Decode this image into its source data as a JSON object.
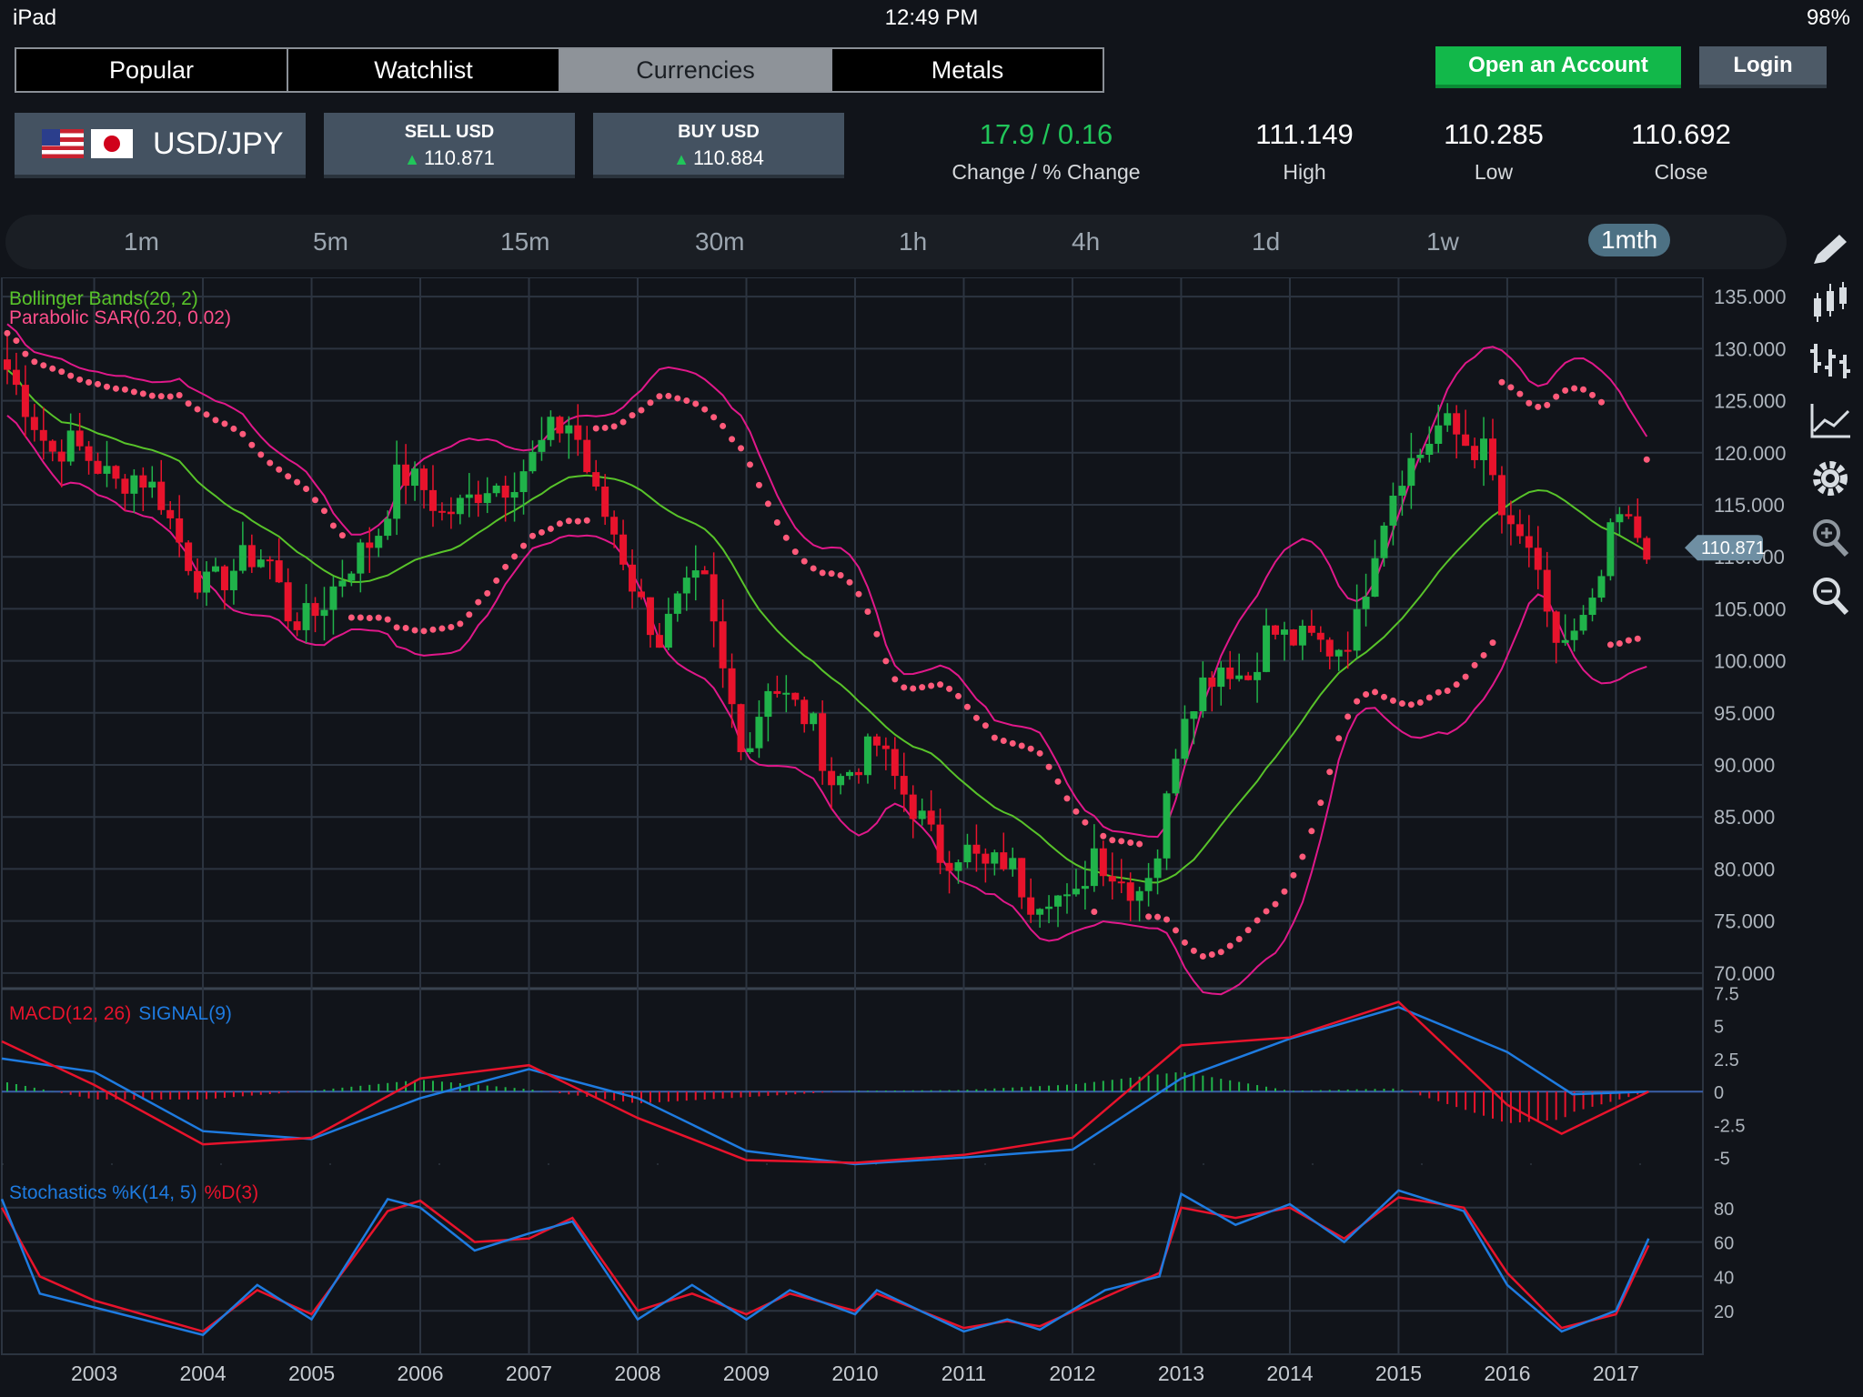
{
  "status": {
    "device": "iPad",
    "time": "12:49 PM",
    "battery": "98%"
  },
  "tabs": [
    {
      "label": "Popular",
      "active": false
    },
    {
      "label": "Watchlist",
      "active": false
    },
    {
      "label": "Currencies",
      "active": true
    },
    {
      "label": "Metals",
      "active": false
    }
  ],
  "actions": {
    "open_account": "Open an Account",
    "login": "Login"
  },
  "instrument": {
    "pair": "USD/JPY"
  },
  "sell": {
    "label": "SELL USD",
    "price": "110.871"
  },
  "buy": {
    "label": "BUY USD",
    "price": "110.884"
  },
  "stats": {
    "change_value": "17.9 / 0.16",
    "change_label": "Change / % Change",
    "high_value": "111.149",
    "high_label": "High",
    "low_value": "110.285",
    "low_label": "Low",
    "close_value": "110.692",
    "close_label": "Close"
  },
  "timeframes": [
    "1m",
    "5m",
    "15m",
    "30m",
    "1h",
    "4h",
    "1d",
    "1w",
    "1mth"
  ],
  "active_timeframe": "1mth",
  "colors": {
    "up": "#20b34a",
    "down": "#e8132c",
    "bollinger": "#e0188a",
    "sma": "#58c32a",
    "sar": "#ff5a7a",
    "macd": "#e8132c",
    "signal": "#1e7be0",
    "accent": "#12b84a"
  },
  "chart_data": [
    {
      "type": "candlestick",
      "indicators": [
        "Bollinger Bands(20, 2)",
        "Parabolic SAR(0.20, 0.02)"
      ],
      "x_ticks": [
        "2003",
        "2004",
        "2005",
        "2006",
        "2007",
        "2008",
        "2009",
        "2010",
        "2011",
        "2012",
        "2013",
        "2014",
        "2015",
        "2016",
        "2017"
      ],
      "y_ticks": [
        "135.000",
        "130.000",
        "125.000",
        "120.000",
        "115.000",
        "110.000",
        "105.000",
        "100.000",
        "95.000",
        "90.000",
        "85.000",
        "80.000",
        "75.000",
        "70.000"
      ],
      "ylim": [
        68.5,
        136.5
      ],
      "xlim": [
        2002.15,
        2017.8
      ],
      "current_price_label": "110.871",
      "close": [
        [
          2002.2,
          128
        ],
        [
          2002.4,
          124
        ],
        [
          2002.6,
          120
        ],
        [
          2002.8,
          121
        ],
        [
          2003.0,
          119
        ],
        [
          2003.2,
          117
        ],
        [
          2003.4,
          118
        ],
        [
          2003.6,
          116
        ],
        [
          2003.8,
          111
        ],
        [
          2004.0,
          107
        ],
        [
          2004.2,
          108
        ],
        [
          2004.4,
          110
        ],
        [
          2004.6,
          110
        ],
        [
          2004.8,
          104
        ],
        [
          2005.0,
          104
        ],
        [
          2005.2,
          107
        ],
        [
          2005.4,
          110
        ],
        [
          2005.6,
          112
        ],
        [
          2005.8,
          118
        ],
        [
          2006.0,
          117
        ],
        [
          2006.2,
          114
        ],
        [
          2006.4,
          115
        ],
        [
          2006.6,
          117
        ],
        [
          2006.8,
          117
        ],
        [
          2007.0,
          119
        ],
        [
          2007.2,
          122
        ],
        [
          2007.4,
          123
        ],
        [
          2007.6,
          116
        ],
        [
          2007.8,
          112
        ],
        [
          2008.0,
          106
        ],
        [
          2008.2,
          102
        ],
        [
          2008.4,
          106
        ],
        [
          2008.6,
          108
        ],
        [
          2008.8,
          98
        ],
        [
          2009.0,
          91
        ],
        [
          2009.2,
          98
        ],
        [
          2009.4,
          96
        ],
        [
          2009.6,
          94
        ],
        [
          2009.8,
          88
        ],
        [
          2010.0,
          90
        ],
        [
          2010.2,
          92
        ],
        [
          2010.4,
          88
        ],
        [
          2010.6,
          85
        ],
        [
          2010.8,
          81
        ],
        [
          2011.0,
          82
        ],
        [
          2011.2,
          80
        ],
        [
          2011.4,
          81
        ],
        [
          2011.6,
          77
        ],
        [
          2011.8,
          78
        ],
        [
          2012.0,
          76
        ],
        [
          2012.2,
          82
        ],
        [
          2012.4,
          79
        ],
        [
          2012.6,
          78
        ],
        [
          2012.8,
          82
        ],
        [
          2013.0,
          95
        ],
        [
          2013.2,
          98
        ],
        [
          2013.4,
          100
        ],
        [
          2013.6,
          98
        ],
        [
          2013.8,
          103
        ],
        [
          2014.0,
          102
        ],
        [
          2014.2,
          102
        ],
        [
          2014.4,
          101
        ],
        [
          2014.6,
          103
        ],
        [
          2014.8,
          112
        ],
        [
          2015.0,
          118
        ],
        [
          2015.2,
          120
        ],
        [
          2015.4,
          123
        ],
        [
          2015.6,
          121
        ],
        [
          2015.8,
          120
        ],
        [
          2016.0,
          112
        ],
        [
          2016.2,
          111
        ],
        [
          2016.4,
          102
        ],
        [
          2016.6,
          102
        ],
        [
          2016.8,
          105
        ],
        [
          2017.0,
          114
        ],
        [
          2017.2,
          112
        ],
        [
          2017.3,
          110.9
        ]
      ]
    },
    {
      "type": "line",
      "title": "MACD(12, 26) SIGNAL(9)",
      "series": [
        {
          "name": "MACD(12, 26)"
        },
        {
          "name": "SIGNAL(9)"
        }
      ],
      "y_ticks": [
        "7.5",
        "5",
        "2.5",
        "0",
        "-2.5",
        "-5"
      ],
      "ylim": [
        -5.5,
        7.8
      ],
      "macd": [
        [
          2002.15,
          3.8
        ],
        [
          2003,
          0.5
        ],
        [
          2004,
          -4
        ],
        [
          2005,
          -3.5
        ],
        [
          2006,
          1
        ],
        [
          2007,
          2
        ],
        [
          2008,
          -2
        ],
        [
          2009,
          -5.2
        ],
        [
          2010,
          -5.4
        ],
        [
          2011,
          -4.8
        ],
        [
          2012,
          -3.5
        ],
        [
          2013,
          3.5
        ],
        [
          2014,
          4.1
        ],
        [
          2015,
          6.8
        ],
        [
          2016,
          -1
        ],
        [
          2016.5,
          -3.2
        ],
        [
          2017.3,
          0
        ]
      ],
      "signal": [
        [
          2002.15,
          2.5
        ],
        [
          2003,
          1.5
        ],
        [
          2004,
          -3
        ],
        [
          2005,
          -3.6
        ],
        [
          2006,
          -0.5
        ],
        [
          2007,
          1.7
        ],
        [
          2008,
          -0.5
        ],
        [
          2009,
          -4.5
        ],
        [
          2010,
          -5.5
        ],
        [
          2011,
          -5.0
        ],
        [
          2012,
          -4.4
        ],
        [
          2013,
          1
        ],
        [
          2014,
          4
        ],
        [
          2015,
          6.4
        ],
        [
          2016,
          3
        ],
        [
          2016.6,
          -0.2
        ],
        [
          2017.3,
          0
        ]
      ]
    },
    {
      "type": "line",
      "title": "Stochastics %K(14, 5) %D(3)",
      "series": [
        {
          "name": "Stochastics %K(14, 5)"
        },
        {
          "name": "%D(3)"
        }
      ],
      "y_ticks": [
        "80",
        "60",
        "40",
        "20"
      ],
      "ylim": [
        0,
        100
      ],
      "k": [
        [
          2002.15,
          85
        ],
        [
          2002.5,
          30
        ],
        [
          2003,
          22
        ],
        [
          2004,
          6
        ],
        [
          2004.5,
          35
        ],
        [
          2005,
          15
        ],
        [
          2005.7,
          85
        ],
        [
          2006,
          80
        ],
        [
          2006.5,
          55
        ],
        [
          2007,
          65
        ],
        [
          2007.4,
          72
        ],
        [
          2008,
          15
        ],
        [
          2008.5,
          35
        ],
        [
          2009,
          15
        ],
        [
          2009.4,
          32
        ],
        [
          2010,
          18
        ],
        [
          2010.2,
          32
        ],
        [
          2011,
          8
        ],
        [
          2011.4,
          15
        ],
        [
          2011.7,
          9
        ],
        [
          2012.3,
          32
        ],
        [
          2012.8,
          40
        ],
        [
          2013.0,
          88
        ],
        [
          2013.5,
          70
        ],
        [
          2014,
          82
        ],
        [
          2014.5,
          60
        ],
        [
          2015,
          90
        ],
        [
          2015.6,
          78
        ],
        [
          2016,
          35
        ],
        [
          2016.5,
          8
        ],
        [
          2017,
          20
        ],
        [
          2017.3,
          62
        ]
      ],
      "d": [
        [
          2002.15,
          80
        ],
        [
          2002.5,
          40
        ],
        [
          2003,
          26
        ],
        [
          2004,
          8
        ],
        [
          2004.5,
          32
        ],
        [
          2005,
          18
        ],
        [
          2005.7,
          78
        ],
        [
          2006,
          84
        ],
        [
          2006.5,
          60
        ],
        [
          2007,
          62
        ],
        [
          2007.4,
          74
        ],
        [
          2008,
          20
        ],
        [
          2008.5,
          30
        ],
        [
          2009,
          18
        ],
        [
          2009.4,
          30
        ],
        [
          2010,
          20
        ],
        [
          2010.2,
          30
        ],
        [
          2011,
          10
        ],
        [
          2011.4,
          14
        ],
        [
          2011.7,
          11
        ],
        [
          2012.3,
          28
        ],
        [
          2012.8,
          42
        ],
        [
          2013.0,
          80
        ],
        [
          2013.5,
          74
        ],
        [
          2014,
          80
        ],
        [
          2014.5,
          62
        ],
        [
          2015,
          86
        ],
        [
          2015.6,
          80
        ],
        [
          2016,
          42
        ],
        [
          2016.5,
          10
        ],
        [
          2017,
          18
        ],
        [
          2017.3,
          58
        ]
      ]
    }
  ]
}
